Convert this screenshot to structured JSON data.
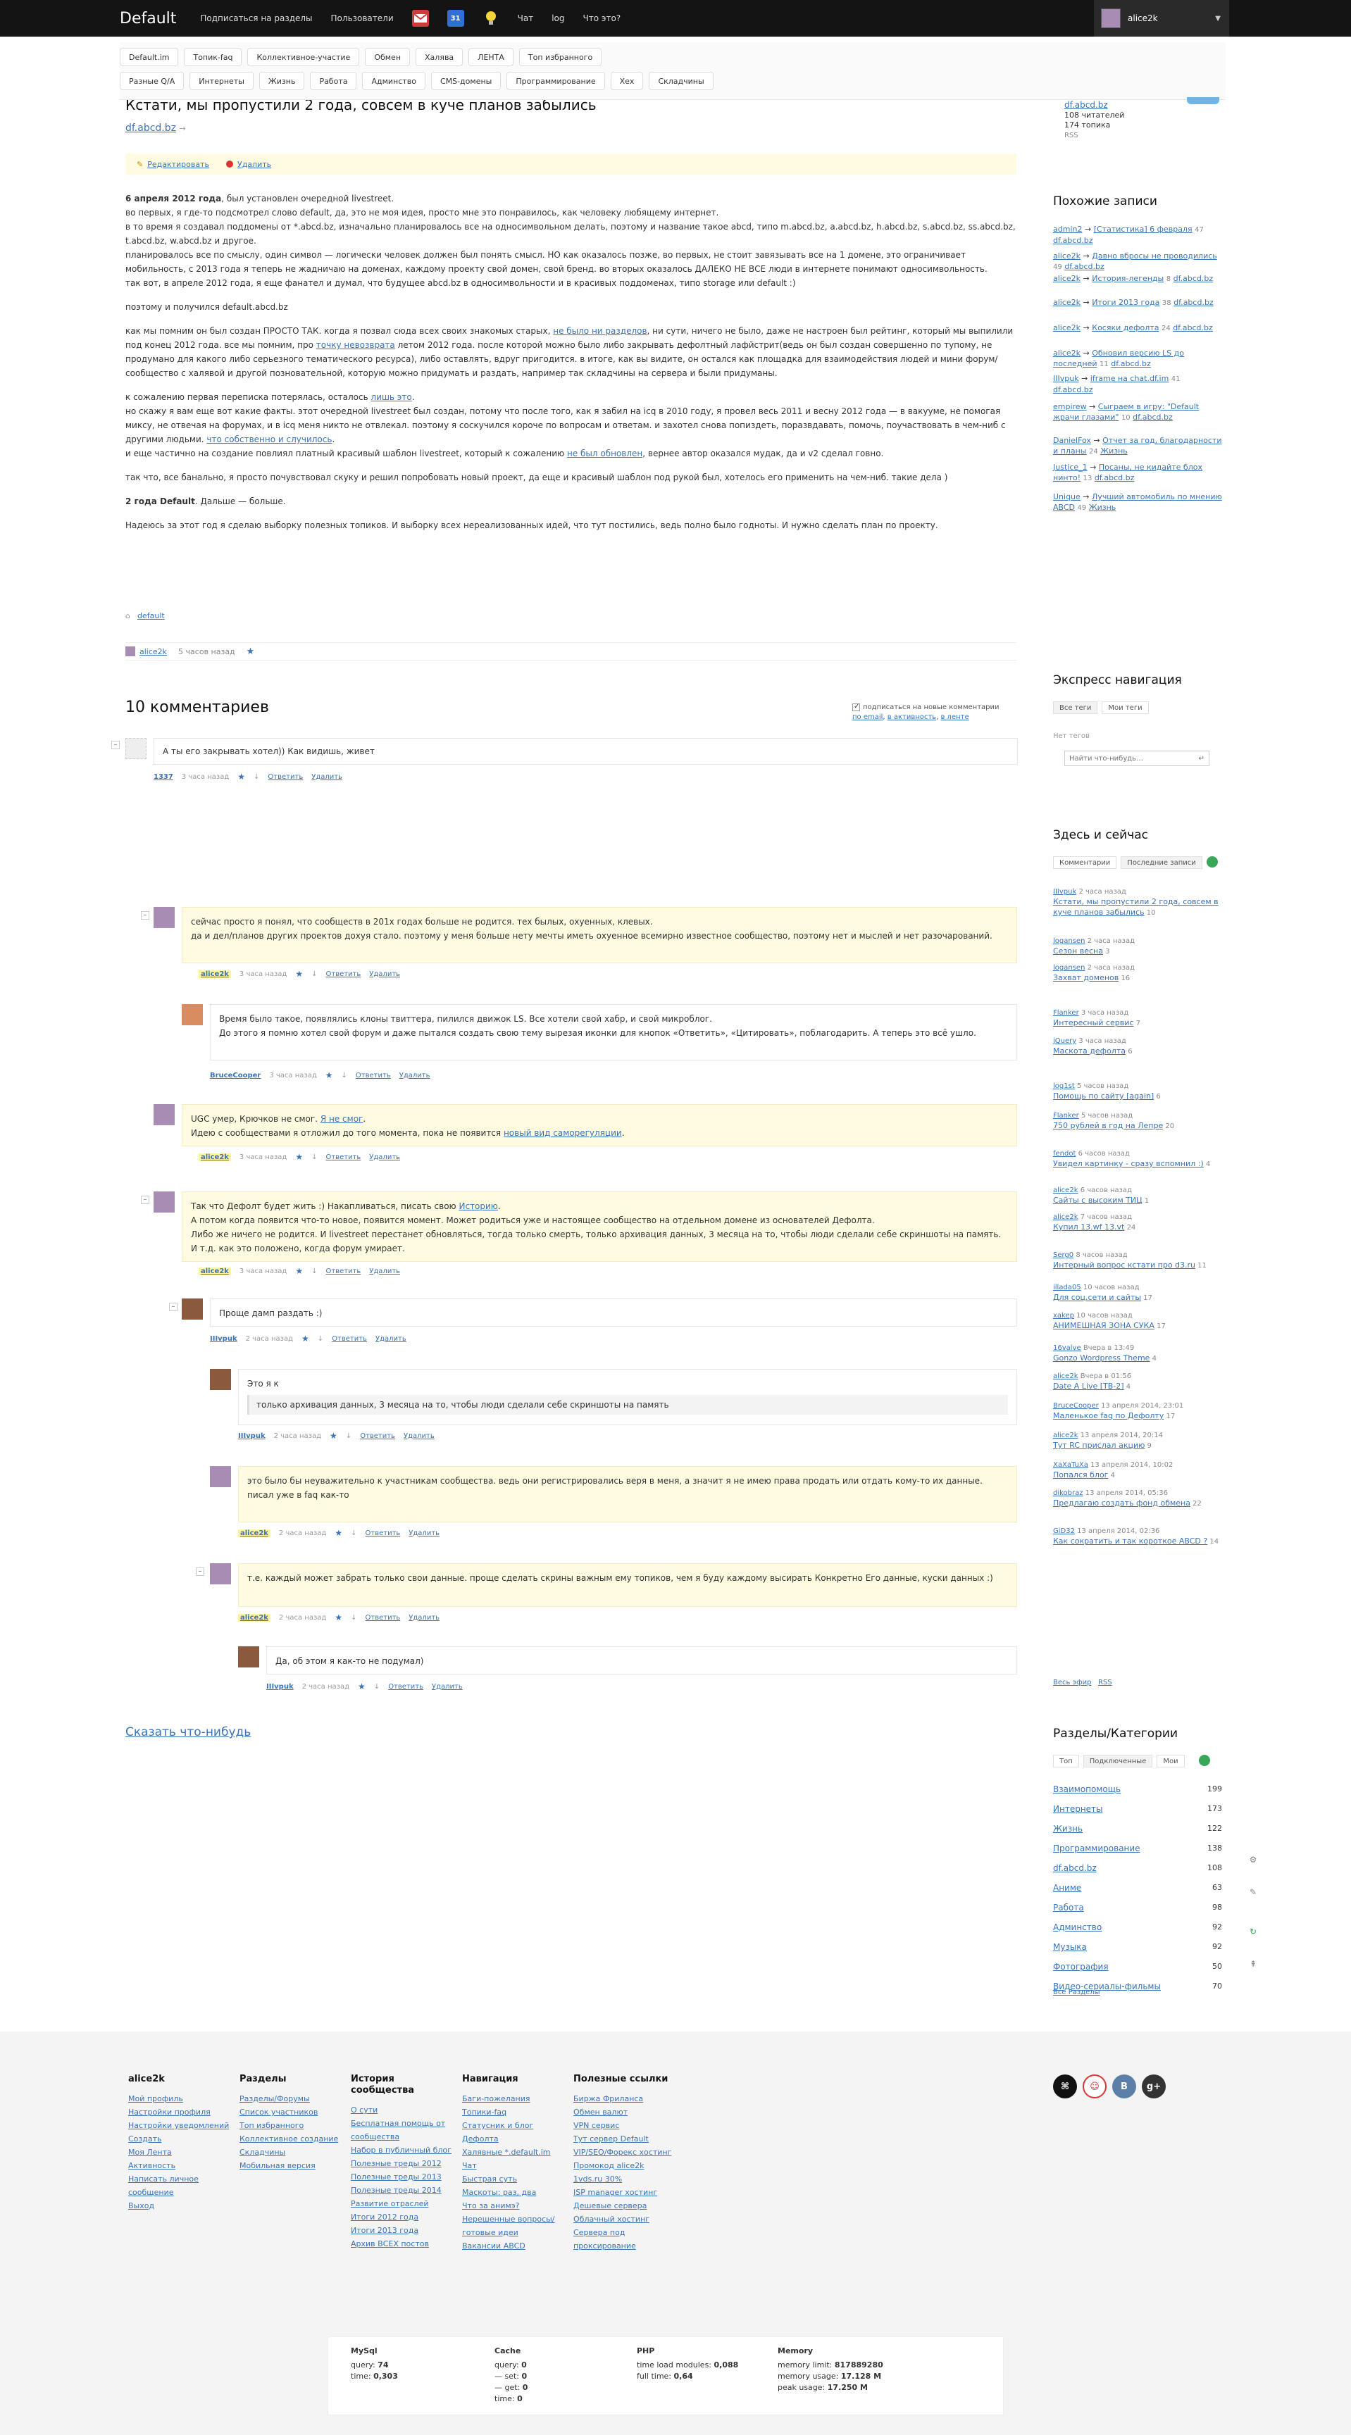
{
  "topbar": {
    "logo": "Default",
    "nav": [
      "Подписаться на разделы",
      "Пользователи"
    ],
    "calendar_day": "31",
    "nav2": [
      "Чат",
      "log",
      "Что это?"
    ],
    "user": "alice2k"
  },
  "tags": {
    "row1": [
      "Default.im",
      "Топик-faq",
      "Коллективное-участие",
      "Обмен",
      "Халява",
      "ЛЕНТА",
      "Топ избранного"
    ],
    "row2": [
      "Разные Q/A",
      "Интернеты",
      "Жизнь",
      "Работа",
      "Админство",
      "CMS-домены",
      "Программирование",
      "Хех",
      "Складчины"
    ]
  },
  "post": {
    "title": "Кстати, мы пропустили 2 года, совсем в куче планов забылись",
    "blog": "df.abcd.bz",
    "blog_suffix": "→",
    "edit": "Редактировать",
    "delete": "Удалить",
    "p1_bold": "6 апреля 2012 года",
    "p1_rest": ", был установлен очередной livestreet.",
    "p1_lines": [
      "во первых, я где-то подсмотрел слово default, да, это не моя идея, просто мне это понравилось, как человеку любящему интернет.",
      "в то время я создавал поддомены от *.abcd.bz, изначально планировалось все на односимвольном делать, поэтому и название такое abcd, типо m.abcd.bz, a.abcd.bz, h.abcd.bz, s.abcd.bz, ss.abcd.bz, t.abcd.bz, w.abcd.bz и другое.",
      "планировалось все по смыслу, один символ — логически человек должен был понять смысл. НО как оказалось позже, во первых, не стоит завязывать все на 1 домене, это ограничивает мобильность, с 2013 года я теперь не жадничаю на доменах, каждому проекту свой домен, свой бренд. во вторых оказалось ДАЛЕКО НЕ ВСЕ люди в интернете понимают односимвольность.",
      "так вот, в апреле 2012 года, я еще фанател и думал, что будущее abcd.bz в односимвольности и в красивых поддоменах, типо storage или default :)"
    ],
    "p2": "поэтому и получился default.abcd.bz",
    "p3_a": "как мы помним он был создан ПРОСТО ТАК. когда я позвал сюда всех своих знакомых старых, ",
    "p3_link1": "не было ни разделов",
    "p3_b": ", ни сути, ничего не было, даже не настроен был рейтинг, который мы выпилили под конец 2012 года. все мы помним, про ",
    "p3_link2": "точку невозврата",
    "p3_c": " летом 2012 года. после которой можно было либо закрывать дефолтный лафйстрит(ведь он был создан совершенно по тупому, не продумано для какого либо серьезного тематического ресурса), либо оставлять, вдруг пригодится. в итоге, как вы видите, он остался как площадка для взаимодействия людей и мини форум/сообщество с халявой и другой позновательной, которую можно придумать и раздать, например так складчины на сервера и были придуманы.",
    "p4_a": "к сожалению первая переписка потерялась, осталось ",
    "p4_link1": "лишь это",
    "p4_b": ".",
    "p4_l2": "но скажу я вам еще вот какие факты. этот очередной livestreet был создан, потому что после того, как я забил на icq в 2010 году, я провел весь 2011 и весну 2012 года — в вакууме, не помогая миксу, не отвечая на форумах, и в icq меня никто не отвлекал. поэтому я соскучился короче по вопросам и ответам. и захотел снова попиздеть, поразвдавать, помочь, поучаствовать в чем-ниб с другими людьми. ",
    "p4_link2": "что собственно и случилось",
    "p4_c": ".",
    "p4_l3": "и еще частично на создание повлиял платный красивый шаблон livestreet, который к сожалению ",
    "p4_link3": "не был обновлен",
    "p4_d": ", вернее автор оказался мудак, да и v2 сделал говно.",
    "p5": "так что, все банально, я просто почувствовал скуку и решил попробовать новый проект, да еще и красивый шаблон под рукой был, хотелось его применить на чем-ниб. такие дела )",
    "p6_bold": "2 года Default",
    "p6_rest": ". Дальше — больше.",
    "p7": "Надеюсь за этот год я сделаю выборку полезных топиков. И выборку всех нереализованных идей, что тут постились, ведь полно было годноты. И нужно сделать план по проекту.",
    "tag": "default",
    "author": "alice2k",
    "time": "5 часов назад"
  },
  "comments": {
    "title": "10 комментариев",
    "subscribe_label": "подписаться на новые комментарии",
    "subscribe_links": [
      "по email",
      "в активность",
      "в ленте"
    ],
    "say": "Сказать что-нибудь",
    "reply": "Ответить",
    "delete": "Удалить",
    "items": [
      {
        "text": [
          "А ты его закрывать хотел)) Как видишь, живет"
        ],
        "author": "1337",
        "time": "3 часа назад"
      },
      {
        "text": [
          "сейчас просто я понял, что сообществ в 201х годах больше не родится. тех былых, охуенных, клевых.",
          "да и дел/планов других проектов дохуя стало. поэтому у меня больше нету мечты иметь охуенное всемирно известное сообщество, поэтому нет и мыслей и нет разочарований."
        ],
        "author": "alice2k",
        "time": "3 часа назад"
      },
      {
        "text": [
          "Время было такое, появлялись клоны твиттера, пилился движок LS. Все хотели свой хабр, и свой микроблог.",
          "До этого я помню хотел свой форум и даже пытался создать свою тему вырезая иконки для кнопок «Ответить», «Цитировать», поблагодарить. А теперь это всё ушло."
        ],
        "author": "BruceCooper",
        "time": "3 часа назад"
      },
      {
        "text_a": "UGC умер, Крючков не смог. ",
        "link_a": "Я не смог",
        "text_b": ".",
        "text_c": "Идею с сообществами я отложил до того момента, пока не появится ",
        "link_b": "новый вид саморегуляции",
        "text_d": ".",
        "author": "alice2k",
        "time": "3 часа назад"
      },
      {
        "text_a": "Так что Дефолт будет жить :) Накапливаться, писать свою ",
        "link_a": "Историю",
        "text_b": ".",
        "text": [
          "А потом когда появится что-то новое, появится момент. Может родиться уже и настоящее сообщество на отдельном домене из основателей Дефолта.",
          "Либо же ничего не родится. И livestreet перестанет обновляться, тогда только смерть, только архивация данных, 3 месяца на то, чтобы люди сделали себе скриншоты на память. И т.д. как это положено, когда форум умирает."
        ],
        "author": "alice2k",
        "time": "3 часа назад"
      },
      {
        "text": [
          "Проще дамп раздать :)"
        ],
        "author": "IIIvpuk",
        "time": "2 часа назад"
      },
      {
        "text": [
          "Это я к"
        ],
        "quote": "только архивация данных, 3 месяца на то, чтобы люди сделали себе скриншоты на память",
        "author": "IIIvpuk",
        "time": "2 часа назад"
      },
      {
        "text": [
          "это было бы неуважительно к участникам сообщества. ведь они регистрировались веря в меня, а значит я не имею права продать или отдать кому-то их данные.",
          "писал уже в faq как-то"
        ],
        "author": "alice2k",
        "time": "2 часа назад"
      },
      {
        "text": [
          "т.е. каждый может забрать только свои данные. проще сделать скрины важным ему топиков, чем я буду каждому высирать Конкретно Его данные, куски данных :)"
        ],
        "author": "alice2k",
        "time": "2 часа назад"
      },
      {
        "text": [
          "Да, об этом я как-то не подумал)"
        ],
        "author": "IIIvpuk",
        "time": "2 часа назад"
      }
    ]
  },
  "sidebar": {
    "blog_link": "df.abcd.bz",
    "readers": "108 читателей",
    "topics": "174 топика",
    "rss": "RSS",
    "similar_title": "Похожие записи",
    "similar": [
      {
        "u": "admin2",
        "t": "[Статистика] 6 февраля",
        "c": "47",
        "b": "df.abcd.bz"
      },
      {
        "u": "alice2k",
        "t": "Давно вбросы не проводились",
        "c": "49",
        "b": "df.abcd.bz"
      },
      {
        "u": "alice2k",
        "t": "История-легенды",
        "c": "8",
        "b": "df.abcd.bz"
      },
      {
        "u": "alice2k",
        "t": "Итоги 2013 года",
        "c": "38",
        "b": "df.abcd.bz"
      },
      {
        "u": "alice2k",
        "t": "Косяки дефолта",
        "c": "24",
        "b": "df.abcd.bz"
      },
      {
        "u": "alice2k",
        "t": "Обновил версию LS до последней",
        "c": "11",
        "b": "df.abcd.bz"
      },
      {
        "u": "IIIvpuk",
        "t": "iframe на chat.df.im",
        "c": "41",
        "b": "df.abcd.bz"
      },
      {
        "u": "empirew",
        "t": "Сыграем в игру: \"Default жрачи глазами\"",
        "c": "10",
        "b": "df.abcd.bz"
      },
      {
        "u": "DanielFox",
        "t": "Отчет за год, благодарности и планы",
        "c": "24",
        "b": "Жизнь"
      },
      {
        "u": "Justice_1",
        "t": "Посаны, не кидайте блох нинто!",
        "c": "13",
        "b": "df.abcd.bz"
      },
      {
        "u": "Unique",
        "t": "Лучший автомобиль по мнению ABCD",
        "c": "49",
        "b": "Жизнь"
      }
    ],
    "express_title": "Экспресс навигация",
    "express_tabs": [
      "Все теги",
      "Мои теги"
    ],
    "no_tags": "Нет тегов",
    "tag_search_placeholder": "Найти что-нибудь…",
    "live_title": "Здесь и сейчас",
    "live_tabs": [
      "Комментарии",
      "Последние записи"
    ],
    "live": [
      {
        "u": "IIIvpuk",
        "time": "2 часа назад",
        "t": "Кстати, мы пропустили 2 года, совсем в куче планов забылись",
        "c": "10"
      },
      {
        "u": "logansen",
        "time": "2 часа назад",
        "t": "Сезон весна",
        "c": "3"
      },
      {
        "u": "logansen",
        "time": "2 часа назад",
        "t": "Захват доменов",
        "c": "16"
      },
      {
        "u": "Flanker",
        "time": "3 часа назад",
        "t": "Интересный сервис",
        "c": "7"
      },
      {
        "u": "jQuery",
        "time": "3 часа назад",
        "t": "Маскота дефолта",
        "c": "6"
      },
      {
        "u": "log1st",
        "time": "5 часов назад",
        "t": "Помощь по сайту [again]",
        "c": "6"
      },
      {
        "u": "Flanker",
        "time": "5 часов назад",
        "t": "750 рублей в год на Лепре",
        "c": "20"
      },
      {
        "u": "fendot",
        "time": "6 часов назад",
        "t": "Увидел картинку - сразу вспомнил :)",
        "c": "4"
      },
      {
        "u": "alice2k",
        "time": "6 часов назад",
        "t": "Сайты с высоким ТИЦ",
        "c": "1"
      },
      {
        "u": "alice2k",
        "time": "7 часов назад",
        "t": "Купил 13.wf 13.vt",
        "c": "24"
      },
      {
        "u": "Serg0",
        "time": "8 часов назад",
        "t": "Интерный вопрос кстати про d3.ru",
        "c": "11"
      },
      {
        "u": "illada05",
        "time": "10 часов назад",
        "t": "Для соц.сети и сайты",
        "c": "17"
      },
      {
        "u": "xakep",
        "time": "10 часов назад",
        "t": "АНИМЕШНАЯ ЗОНА СУКА",
        "c": "17"
      },
      {
        "u": "16valve",
        "time": "Вчера в 13:49",
        "t": "Gonzo Wordpress Theme",
        "c": "4"
      },
      {
        "u": "alice2k",
        "time": "Вчера в 01:56",
        "t": "Date A Live [TB-2]",
        "c": "4"
      },
      {
        "u": "BruceCooper",
        "time": "13 апреля 2014, 23:01",
        "t": "Маленькое faq по Дефолту",
        "c": "17"
      },
      {
        "u": "alice2k",
        "time": "13 апреля 2014, 20:14",
        "t": "Тут RC прислал акцию",
        "c": "9"
      },
      {
        "u": "XaXaTuXa",
        "time": "13 апреля 2014, 10:02",
        "t": "Попался блог",
        "c": "4"
      },
      {
        "u": "dikobraz",
        "time": "13 апреля 2014, 05:36",
        "t": "Предлагаю создать фонд обмена",
        "c": "22"
      },
      {
        "u": "GiD32",
        "time": "13 апреля 2014, 02:36",
        "t": "Как сократить и так короткое ABCD ?",
        "c": "14"
      }
    ],
    "live_all": "Весь эфир",
    "live_rss": "RSS",
    "cats_title": "Разделы/Категории",
    "cats_tabs": [
      "Топ",
      "Подключенные",
      "Мои"
    ],
    "cats": [
      {
        "n": "Взаимопомощь",
        "c": "199"
      },
      {
        "n": "Интернеты",
        "c": "173"
      },
      {
        "n": "Жизнь",
        "c": "122"
      },
      {
        "n": "Программирование",
        "c": "138"
      },
      {
        "n": "df.abcd.bz",
        "c": "108"
      },
      {
        "n": "Аниме",
        "c": "63"
      },
      {
        "n": "Работа",
        "c": "98"
      },
      {
        "n": "Админство",
        "c": "92"
      },
      {
        "n": "Музыка",
        "c": "92"
      },
      {
        "n": "Фотография",
        "c": "50"
      },
      {
        "n": "Видео-сериалы-фильмы",
        "c": "70"
      }
    ],
    "all_cats": "Все Разделы"
  },
  "footer": {
    "col1_title": "alice2k",
    "col1": [
      "Мой профиль",
      "Настройки профиля",
      "Настройки уведомлений",
      "Создать",
      "Моя Лента",
      "Активность",
      "Написать личное сообщение",
      "Выход"
    ],
    "col2_title": "Разделы",
    "col2": [
      "Разделы/Форумы",
      "Список участников",
      "Топ избранного",
      "Коллективное создание",
      "Складчины",
      "Мобильная версия"
    ],
    "col3_title": "История сообщества",
    "col3": [
      "О сути",
      "Бесплатная помощь от сообщества",
      "Набор в публичный блог",
      "Полезные треды 2012",
      "Полезные треды 2013",
      "Полезные треды 2014",
      "Развитие отраслей",
      "Итоги 2012 года",
      "Итоги 2013 года",
      "Архив ВСЕХ постов"
    ],
    "col4_title": "Навигация",
    "col4": [
      "Баги-пожелания",
      "Топики-faq",
      "Статусник и блог Дефолта",
      "Халявные *.default.im",
      "Чат",
      "Быстрая суть",
      "Маскоты: раз, два",
      "Что за анимэ?",
      "Нерешенные вопросы/готовые идеи",
      "Вакансии ABCD"
    ],
    "col5_title": "Полезные ссылки",
    "col5": [
      "Биржа Фриланса",
      "Обмен валют",
      "VPN сервис",
      "Тут сервер Default",
      "VIP/SEO/Форекс хостинг",
      "Промокод alice2k",
      "1vds.ru 30%",
      "ISP manager хостинг",
      "Дешевые сервера",
      "Облачный хостинг",
      "Сервера под проксирование"
    ]
  },
  "stats": {
    "mysql_title": "MySql",
    "mysql_query_label": "query:",
    "mysql_query": "74",
    "mysql_time_label": "time:",
    "mysql_time": "0,303",
    "cache_title": "Cache",
    "cache_query_label": "query:",
    "cache_query": "0",
    "cache_set_label": "— set:",
    "cache_set": "0",
    "cache_get_label": "— get:",
    "cache_get": "0",
    "cache_time_label": "time:",
    "cache_time": "0",
    "php_title": "PHP",
    "php_modules_label": "time load modules:",
    "php_modules": "0,088",
    "php_full_label": "full time:",
    "php_full": "0,64",
    "mem_title": "Memory",
    "mem_limit_label": "memory limit:",
    "mem_limit": "817889280",
    "mem_usage_label": "memory usage:",
    "mem_usage": "17.128 M",
    "mem_peak_label": "peak usage:",
    "mem_peak": "17.250 M"
  },
  "colors": {
    "accent": "#3a73b8",
    "highlight": "#fffbe0",
    "topbar": "#141414",
    "green": "#3aa657"
  }
}
